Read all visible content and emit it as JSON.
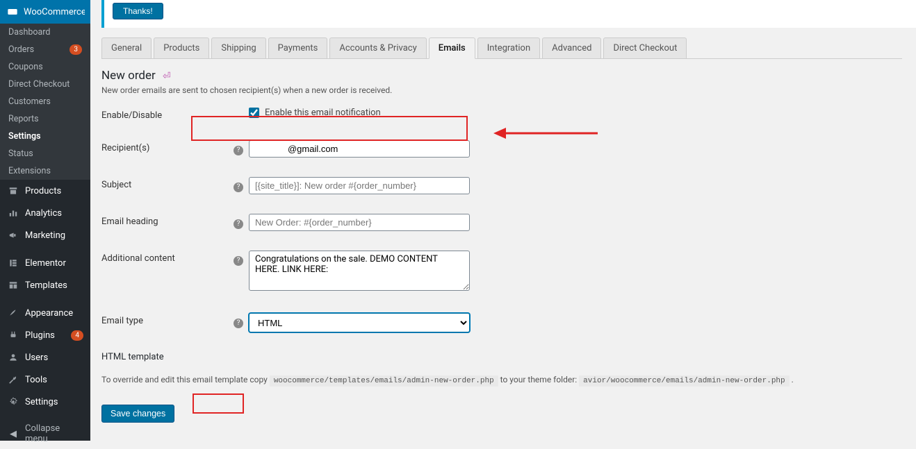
{
  "sidebar": {
    "woo_label": "WooCommerce",
    "sub": [
      {
        "label": "Dashboard"
      },
      {
        "label": "Orders",
        "badge": "3"
      },
      {
        "label": "Coupons"
      },
      {
        "label": "Direct Checkout"
      },
      {
        "label": "Customers"
      },
      {
        "label": "Reports"
      },
      {
        "label": "Settings",
        "active": true
      },
      {
        "label": "Status"
      },
      {
        "label": "Extensions"
      }
    ],
    "main": [
      {
        "icon": "archive",
        "label": "Products"
      },
      {
        "icon": "chart",
        "label": "Analytics"
      },
      {
        "icon": "megaphone",
        "label": "Marketing"
      },
      {
        "icon": "elementor",
        "label": "Elementor"
      },
      {
        "icon": "templates",
        "label": "Templates"
      },
      {
        "icon": "brush",
        "label": "Appearance"
      },
      {
        "icon": "plug",
        "label": "Plugins",
        "badge": "4"
      },
      {
        "icon": "user",
        "label": "Users"
      },
      {
        "icon": "wrench",
        "label": "Tools"
      },
      {
        "icon": "gear",
        "label": "Settings"
      }
    ],
    "collapse": "Collapse menu"
  },
  "notice": {
    "dismiss": "Thanks!"
  },
  "tabs": [
    "General",
    "Products",
    "Shipping",
    "Payments",
    "Accounts & Privacy",
    "Emails",
    "Integration",
    "Advanced",
    "Direct Checkout"
  ],
  "active_tab": "Emails",
  "page": {
    "title": "New order",
    "desc": "New order emails are sent to chosen recipient(s) when a new order is received."
  },
  "form": {
    "enable_label": "Enable/Disable",
    "enable_check_label": "Enable this email notification",
    "enable_checked": true,
    "recipients_label": "Recipient(s)",
    "recipients_value": "             @gmail.com",
    "subject_label": "Subject",
    "subject_placeholder": "[{site_title}]: New order #{order_number}",
    "heading_label": "Email heading",
    "heading_placeholder": "New Order: #{order_number}",
    "additional_label": "Additional content",
    "additional_value": "Congratulations on the sale. DEMO CONTENT HERE. LINK HERE:",
    "type_label": "Email type",
    "type_value": "HTML",
    "template_h": "HTML template",
    "template_line_a": "To override and edit this email template copy ",
    "template_code_a": "woocommerce/templates/emails/admin-new-order.php",
    "template_line_b": " to your theme folder: ",
    "template_code_b": "avior/woocommerce/emails/admin-new-order.php",
    "template_line_c": " .",
    "save": "Save changes"
  }
}
